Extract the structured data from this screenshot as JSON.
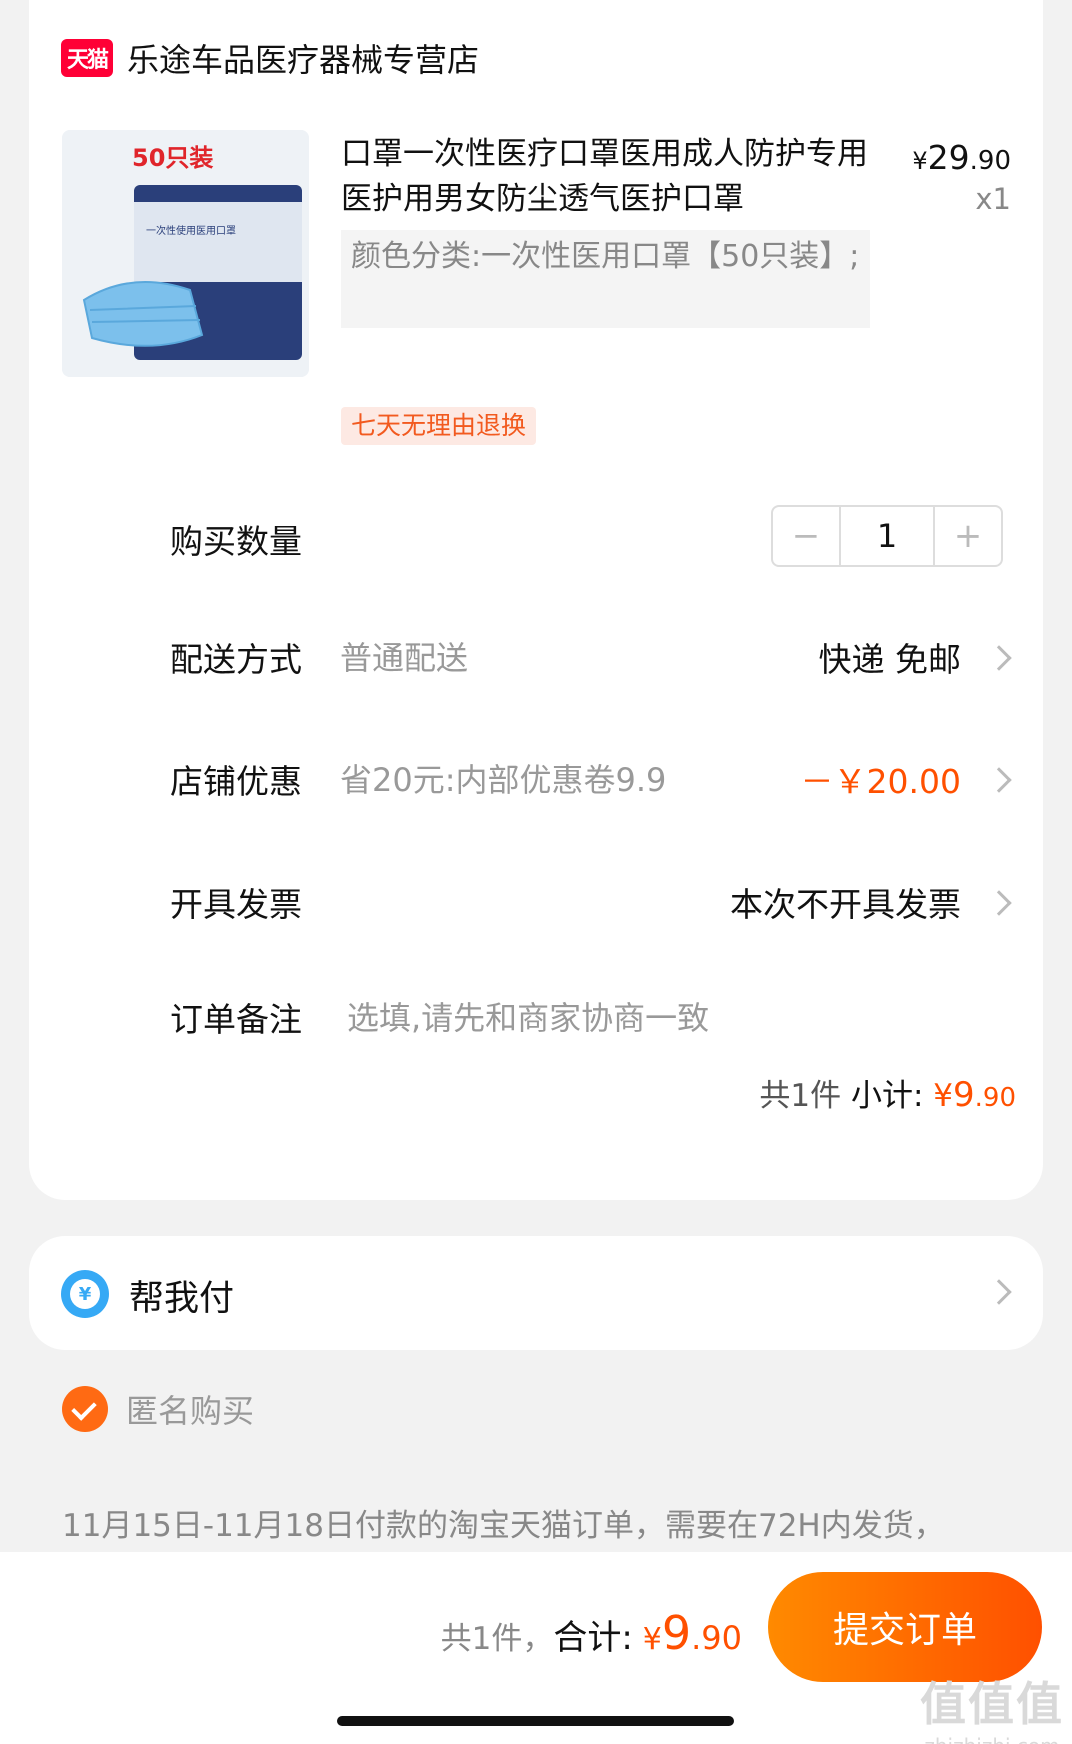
{
  "store": {
    "logo_text": "天猫",
    "name": "乐途车品医疗器械专营店"
  },
  "product": {
    "image_caption": "50只装",
    "image_subtext": "一次性使用医用口罩",
    "title": "口罩一次性医疗口罩医用成人防护专用医护用男女防尘透气医护口罩",
    "price_yen": "¥",
    "price_int": "29",
    "price_cents": ".90",
    "quantity_mark": "x1",
    "sku": "颜色分类:一次性医用口罩【50只装】;",
    "return_tag": "七天无理由退换"
  },
  "quantity": {
    "label": "购买数量",
    "minus": "−",
    "value": "1",
    "plus": "+"
  },
  "delivery": {
    "label": "配送方式",
    "sub": "普通配送",
    "value": "快递 免邮"
  },
  "coupon": {
    "label": "店铺优惠",
    "sub": "省20元:内部优惠卷9.9",
    "value": "－￥20.00"
  },
  "invoice": {
    "label": "开具发票",
    "value": "本次不开具发票"
  },
  "remark": {
    "label": "订单备注",
    "placeholder": "选填,请先和商家协商一致"
  },
  "subtotal": {
    "count": "共1件",
    "label": "小计:",
    "yen": "¥",
    "int": "9",
    "cents": ".90"
  },
  "helpay": {
    "icon_glyph": "¥",
    "label": "帮我付"
  },
  "anonymous": {
    "label": "匿名购买"
  },
  "notice": "11月15日-11月18日付款的淘宝天猫订单，需要在72H内发货，",
  "bottom": {
    "count": "共1件，",
    "total_label": "合计:",
    "yen": "¥",
    "int": "9",
    "cents": ".90",
    "submit": "提交订单"
  },
  "watermark": {
    "big": "值值值",
    "small": "zhizhizhi.com"
  },
  "colors": {
    "accent": "#ff5000",
    "tmall": "#ff0036",
    "background": "#f2f2f2"
  }
}
